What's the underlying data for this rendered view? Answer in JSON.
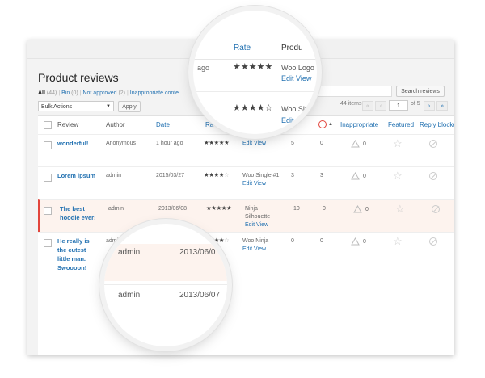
{
  "page": {
    "title": "Product reviews"
  },
  "filters": {
    "all_label": "All",
    "all_count": "(44)",
    "bin_label": "Bin",
    "bin_count": "(0)",
    "not_approved_label": "Not approved",
    "not_approved_count": "(2)",
    "inappropriate_label": "Inappropriate conte",
    "separator": "|"
  },
  "toolbar": {
    "bulk_actions": "Bulk Actions",
    "apply_label": "Apply",
    "search_button": "Search reviews",
    "items_count": "44 items",
    "current_page": "1",
    "of_pages": "of 5",
    "first_page": "«",
    "prev_page": "‹",
    "next_page": "›",
    "last_page": "»"
  },
  "table": {
    "columns": {
      "review": "Review",
      "author": "Author",
      "date": "Date",
      "rate": "Ra",
      "inappropriate": "Inappropriate",
      "featured": "Featured",
      "reply_blocked": "Reply blocke"
    },
    "rows": [
      {
        "title": [
          "wonderful!"
        ],
        "author": "Anonymous",
        "date": "1 hour ago",
        "rating": 5,
        "product": [],
        "c1": "5",
        "c2": "0",
        "inappropriate": "0",
        "highlighted": false
      },
      {
        "title": [
          "Lorem ipsum"
        ],
        "author": "admin",
        "date": "2015/03/27",
        "rating": 4,
        "product": [
          "Woo Single #1"
        ],
        "c1": "3",
        "c2": "3",
        "inappropriate": "0",
        "highlighted": false
      },
      {
        "title": [
          "The best",
          "hoodie ever!"
        ],
        "author": "admin",
        "date": "2013/06/08",
        "rating": 5,
        "product": [
          "Ninja",
          "Silhouette"
        ],
        "c1": "10",
        "c2": "0",
        "inappropriate": "0",
        "highlighted": true
      },
      {
        "title": [
          "He really is",
          "the cutest",
          "little man.",
          "Swoooon!"
        ],
        "author": "admin",
        "date": "",
        "rating": 4,
        "product": [
          "Woo Ninja"
        ],
        "c1": "0",
        "c2": "0",
        "inappropriate": "0",
        "highlighted": false
      }
    ],
    "edit_label": "Edit",
    "view_label": "View",
    "star_glyph": "★",
    "hollow_star_glyph": "☆"
  },
  "magnifier_top": {
    "rate_header": "Rate",
    "product_header": "Produ",
    "ago_text": "ago",
    "date_partial": "/27",
    "product_partial": "Woo Logo",
    "product_partial2": "Woo Sing",
    "edit_label": "Edit",
    "view_label": "View",
    "ratings": [
      5,
      4
    ]
  },
  "magnifier_bottom": {
    "rows": [
      {
        "author": "admin",
        "date": "2013/06/0"
      },
      {
        "author": "admin",
        "date": "2013/06/07"
      }
    ]
  },
  "colors": {
    "link": "#2271b1",
    "highlight_bg": "#fdf3ee",
    "highlight_border": "#e2453c"
  }
}
